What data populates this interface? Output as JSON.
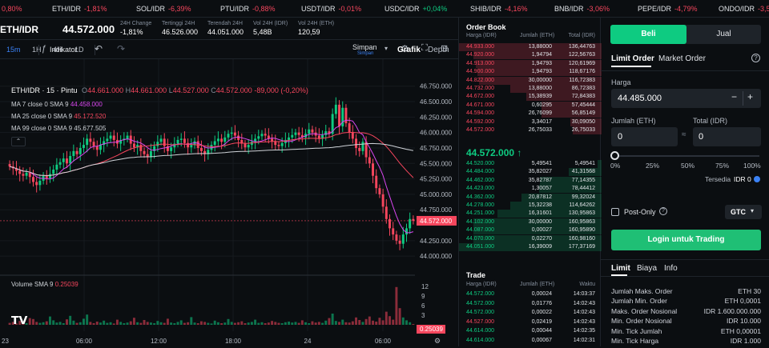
{
  "ticker": [
    {
      "name": "",
      "change": "0,80%",
      "dir": "neg",
      "x": -2
    },
    {
      "name": "ETH/IDR",
      "change": "-1,81%",
      "dir": "neg",
      "x": 65
    },
    {
      "name": "SOL/IDR",
      "change": "-6,39%",
      "dir": "neg",
      "x": 170
    },
    {
      "name": "PTU/IDR",
      "change": "-0,88%",
      "dir": "neg",
      "x": 275
    },
    {
      "name": "USDT/IDR",
      "change": "-0,01%",
      "dir": "neg",
      "x": 376
    },
    {
      "name": "USDC/IDR",
      "change": "+0,04%",
      "dir": "pos",
      "x": 480
    },
    {
      "name": "SHIB/IDR",
      "change": "-4,16%",
      "dir": "neg",
      "x": 587
    },
    {
      "name": "BNB/IDR",
      "change": "-3,06%",
      "dir": "neg",
      "x": 692
    },
    {
      "name": "PEPE/IDR",
      "change": "-4,79%",
      "dir": "neg",
      "x": 796
    },
    {
      "name": "ONDO/IDR",
      "change": "-3,58",
      "dir": "neg",
      "x": 897
    }
  ],
  "header": {
    "pair": "ETH/IDR",
    "last_price": "44.572.000",
    "stats": [
      {
        "label": "24H Change",
        "value": "-1,81%",
        "dir": "neg"
      },
      {
        "label": "Tertinggi 24H",
        "value": "46.526.000",
        "dir": ""
      },
      {
        "label": "Terendah 24H",
        "value": "44.051.000",
        "dir": ""
      },
      {
        "label": "Vol 24H (IDR)",
        "value": "5,48B",
        "dir": ""
      },
      {
        "label": "Vol 24H (ETH)",
        "value": "120,59",
        "dir": ""
      }
    ]
  },
  "toolbar": {
    "timeframes": [
      "15m",
      "1H",
      "4H",
      "1D"
    ],
    "active_tf": "15m",
    "indicator_label": "Indikator",
    "save_label": "Simpan",
    "save_sub": "Simpan",
    "tab_chart": "Grafik",
    "tab_depth": "Depth"
  },
  "chart_legend": {
    "title": "ETH/IDR · 15 · Pintu",
    "o": "44.661.000",
    "h": "44.661.000",
    "l": "44.527.000",
    "c": "44.572.000",
    "chg": "-89,000 (-0,20%)",
    "ma7_label": "MA 7 close 0 SMA 9",
    "ma7_val": "44.458.000",
    "ma25_label": "MA 25 close 0 SMA 9",
    "ma25_val": "45.172.520",
    "ma99_label": "MA 99 close 0 SMA 9",
    "ma99_val": "45.677.505",
    "vol_label": "Volume SMA 9",
    "vol_val": "0.25039",
    "price_tag": "44.572.000",
    "vol_tag": "0.25039",
    "colors": {
      "ma7": "#d946ef",
      "ma25": "#f6465d",
      "ma99": "#cfd3d8",
      "up": "#0ecb81",
      "down": "#f6465d"
    }
  },
  "chart_data": {
    "type": "candlestick",
    "price_axis": [
      "46.750.000",
      "46.500.000",
      "46.250.000",
      "46.000.000",
      "45.750.000",
      "45.500.000",
      "45.250.000",
      "45.000.000",
      "44.750.000",
      "44.250.000",
      "44.000.000"
    ],
    "price_axis_values": [
      46750,
      46500,
      46250,
      46000,
      45750,
      45500,
      45250,
      45000,
      44750,
      44250,
      44000
    ],
    "volume_axis": [
      "12",
      "9",
      "6",
      "3"
    ],
    "volume_axis_values": [
      12,
      9,
      6,
      3
    ],
    "time_axis": [
      "23",
      "06:00",
      "12:00",
      "18:00",
      "24",
      "06:00"
    ],
    "ylim": [
      43950,
      46850
    ],
    "vol_ylim": [
      0,
      12.5
    ],
    "last_price": 44572,
    "candles_close": [
      45450,
      45420,
      45380,
      45330,
      45300,
      45350,
      45280,
      45200,
      45150,
      45220,
      45300,
      45260,
      45330,
      45400,
      45480,
      45520,
      45580,
      45500,
      45620,
      45700,
      45650,
      45750,
      45800,
      45900,
      45850,
      45780,
      45720,
      45800,
      45860,
      45900,
      45950,
      45880,
      45820,
      45880,
      45900,
      45950,
      45820,
      45760,
      45800,
      45700,
      45650,
      45600,
      45700,
      45780,
      45850,
      45900,
      45780,
      45700,
      45760,
      45820,
      45880,
      45900,
      45830,
      45760,
      45800,
      45860,
      45750,
      45700,
      45650,
      45720,
      45800,
      45860,
      45900,
      45850,
      45920,
      45980,
      46000,
      45950,
      45880,
      45820,
      45760,
      45800,
      45850,
      45900,
      45940,
      45980,
      45950,
      45900,
      45860,
      45800,
      45780,
      45830,
      45880,
      45920,
      45960,
      46000,
      45960,
      45920,
      45980,
      46050,
      46000,
      45950,
      45900,
      45960,
      46020,
      45980,
      46300,
      46450,
      46100,
      46400,
      46150,
      46000,
      45900,
      45750,
      45700,
      45850,
      45600,
      45500,
      45300,
      45100,
      45000,
      44800,
      44600,
      44450,
      44350,
      44250,
      44200,
      44350,
      44450,
      44600,
      44572
    ],
    "volumes": [
      0.6,
      0.9,
      0.4,
      1.2,
      0.7,
      0.5,
      2.1,
      1.8,
      0.9,
      0.6,
      0.8,
      1.1,
      2.6,
      1.4,
      0.7,
      0.9,
      0.5,
      1.7,
      2.8,
      1.3,
      0.6,
      0.8,
      1.9,
      3.2,
      0.9,
      0.5,
      1.0,
      0.7,
      1.3,
      0.6,
      0.8,
      0.4,
      1.6,
      0.9,
      0.5,
      0.7,
      1.1,
      2.2,
      0.8,
      0.6,
      1.5,
      0.9,
      0.7,
      0.5,
      1.2,
      0.8,
      0.6,
      1.9,
      0.7,
      0.5,
      0.9,
      1.4,
      0.6,
      0.8,
      2.4,
      0.7,
      0.5,
      1.1,
      0.9,
      0.6,
      0.4,
      1.3,
      0.8,
      0.5,
      0.7,
      1.8,
      0.9,
      0.6,
      0.8,
      1.1,
      0.5,
      0.7,
      0.9,
      1.6,
      0.6,
      0.8,
      0.5,
      0.7,
      1.2,
      0.9,
      0.6,
      0.5,
      0.8,
      1.0,
      0.7,
      0.9,
      0.6,
      1.4,
      0.8,
      0.5,
      1.1,
      0.7,
      0.9,
      0.6,
      1.3,
      2.1,
      3.5,
      1.2,
      0.9,
      1.6,
      0.8,
      0.7,
      1.1,
      2.3,
      1.5,
      0.9,
      1.8,
      2.6,
      1.3,
      1.0,
      2.2,
      1.4,
      4.1,
      2.7,
      1.6,
      11.8,
      5.2,
      2.3,
      1.4,
      0.8,
      0.25
    ]
  },
  "orderbook": {
    "title": "Order Book",
    "cols": [
      "Harga (IDR)",
      "Jumlah (ETH)",
      "Total (IDR)"
    ],
    "asks": [
      [
        "44.933.000",
        "13,88000",
        "136,44763",
        1.0
      ],
      [
        "44.920.000",
        "1,94794",
        "122,56763",
        0.9
      ],
      [
        "44.913.000",
        "1,94793",
        "120,61969",
        0.88
      ],
      [
        "44.900.000",
        "1,94793",
        "118,67176",
        0.87
      ],
      [
        "44.822.000",
        "30,00000",
        "116,72383",
        0.86
      ],
      [
        "44.732.000",
        "13,88000",
        "86,72383",
        0.64
      ],
      [
        "44.672.000",
        "15,38939",
        "72,84383",
        0.53
      ],
      [
        "44.671.000",
        "0,60295",
        "57,45444",
        0.42
      ],
      [
        "44.594.000",
        "26,76099",
        "56,85149",
        0.42
      ],
      [
        "44.592.000",
        "3,34017",
        "30,09050",
        0.22
      ],
      [
        "44.572.000",
        "26,75033",
        "26,75033",
        0.2
      ]
    ],
    "mid_price": "44.572.000",
    "mid_arrow": "↑",
    "bids": [
      [
        "44.520.000",
        "5,49541",
        "5,49541",
        0.03
      ],
      [
        "44.484.000",
        "35,82027",
        "41,31568",
        0.23
      ],
      [
        "44.462.000",
        "35,82787",
        "77,14355",
        0.43
      ],
      [
        "44.423.000",
        "1,30057",
        "78,44412",
        0.44
      ],
      [
        "44.362.000",
        "20,87812",
        "99,32024",
        0.56
      ],
      [
        "44.278.000",
        "15,32238",
        "114,64262",
        0.64
      ],
      [
        "44.251.000",
        "16,31601",
        "130,95863",
        0.73
      ],
      [
        "44.102.000",
        "30,00000",
        "160,95863",
        0.9
      ],
      [
        "44.087.000",
        "0,00027",
        "160,95890",
        0.9
      ],
      [
        "44.070.000",
        "0,02270",
        "160,98160",
        0.9
      ],
      [
        "44.051.000",
        "16,39009",
        "177,37169",
        1.0
      ]
    ]
  },
  "trades": {
    "title": "Trade",
    "cols": [
      "Harga (IDR)",
      "Jumlah (ETH)",
      "Waktu"
    ],
    "rows": [
      [
        "44.572.000",
        "0,00024",
        "14:03:37",
        "pos"
      ],
      [
        "44.572.000",
        "0,01776",
        "14:02:43",
        "pos"
      ],
      [
        "44.572.000",
        "0,00022",
        "14:02:43",
        "pos"
      ],
      [
        "44.527.000",
        "0,02419",
        "14:02:43",
        "neg"
      ],
      [
        "44.614.000",
        "0,00044",
        "14:02:35",
        "pos"
      ],
      [
        "44.614.000",
        "0,00067",
        "14:02:31",
        "pos"
      ]
    ]
  },
  "form": {
    "buy_label": "Beli",
    "sell_label": "Jual",
    "tab_limit": "Limit Order",
    "tab_market": "Market Order",
    "price_label": "Harga",
    "price_value": "44.485.000",
    "minus": "−",
    "plus": "+",
    "amount_label": "Jumlah (ETH)",
    "amount_value": "0",
    "total_label": "Total (IDR)",
    "total_value": "0",
    "approx": "≈",
    "pcts": [
      "0%",
      "25%",
      "50%",
      "75%",
      "100%"
    ],
    "available_label": "Tersedia",
    "available_value": "IDR 0",
    "post_only": "Post-Only",
    "gtc": "GTC",
    "login_button": "Login untuk Trading",
    "info_tabs": [
      "Limit",
      "Biaya",
      "Info"
    ],
    "info_rows": [
      [
        "Jumlah Maks. Order",
        "ETH 30"
      ],
      [
        "Jumlah Min. Order",
        "ETH 0,0001"
      ],
      [
        "Maks. Order Nosional",
        "IDR 1.600.000.000"
      ],
      [
        "Min. Order Nosional",
        "IDR 10.000"
      ],
      [
        "Min. Tick Jumlah",
        "ETH 0,00001"
      ],
      [
        "Min. Tick Harga",
        "IDR 1.000"
      ]
    ],
    "colors": {
      "buy": "#0ecb81",
      "login": "#1fbf75"
    }
  }
}
